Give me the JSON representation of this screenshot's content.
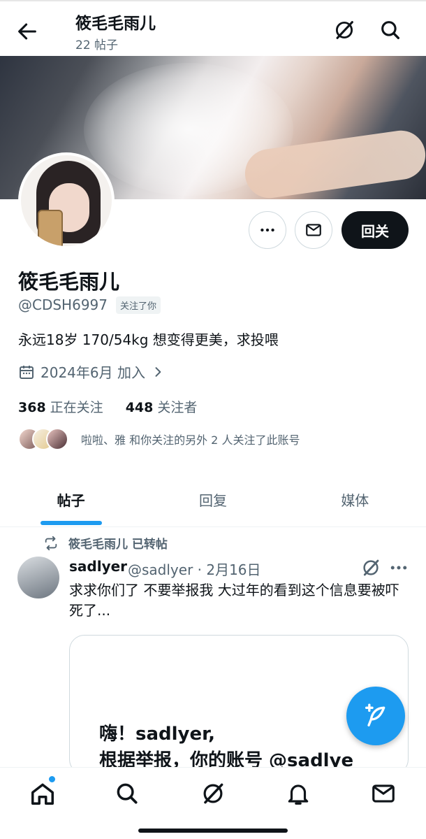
{
  "header": {
    "title": "筱毛毛雨儿",
    "post_count": "22 帖子",
    "back_icon": "back-arrow-icon",
    "grok_icon": "grok-icon",
    "search_icon": "search-icon"
  },
  "profile": {
    "display_name": "筱毛毛雨儿",
    "handle": "@CDSH6997",
    "follows_you": "关注了你",
    "bio": "永远18岁 170/54kg 想变得更美，求投喂",
    "joined": "2024年6月 加入",
    "following_count": "368",
    "following_label": "正在关注",
    "followers_count": "448",
    "followers_label": "关注者",
    "mutual_text": "啦啦、雅 和你关注的另外 2 人关注了此账号",
    "follow_back_label": "回关"
  },
  "tabs": [
    {
      "label": "帖子",
      "active": true
    },
    {
      "label": "回复",
      "active": false
    },
    {
      "label": "媒体",
      "active": false
    }
  ],
  "post": {
    "repost_text": "筱毛毛雨儿 已转帖",
    "author": "sadlyer",
    "meta": "@sadlyer · 2月16日",
    "text": "求求你们了 不要举报我 大过年的看到这个信息要被吓死了...",
    "card_line1": "嗨！sadlyer,",
    "card_line2": "根据举报，你的账号 @sadlye"
  },
  "colors": {
    "accent": "#1d9bf0",
    "text": "#0f1419",
    "secondary": "#536471"
  }
}
